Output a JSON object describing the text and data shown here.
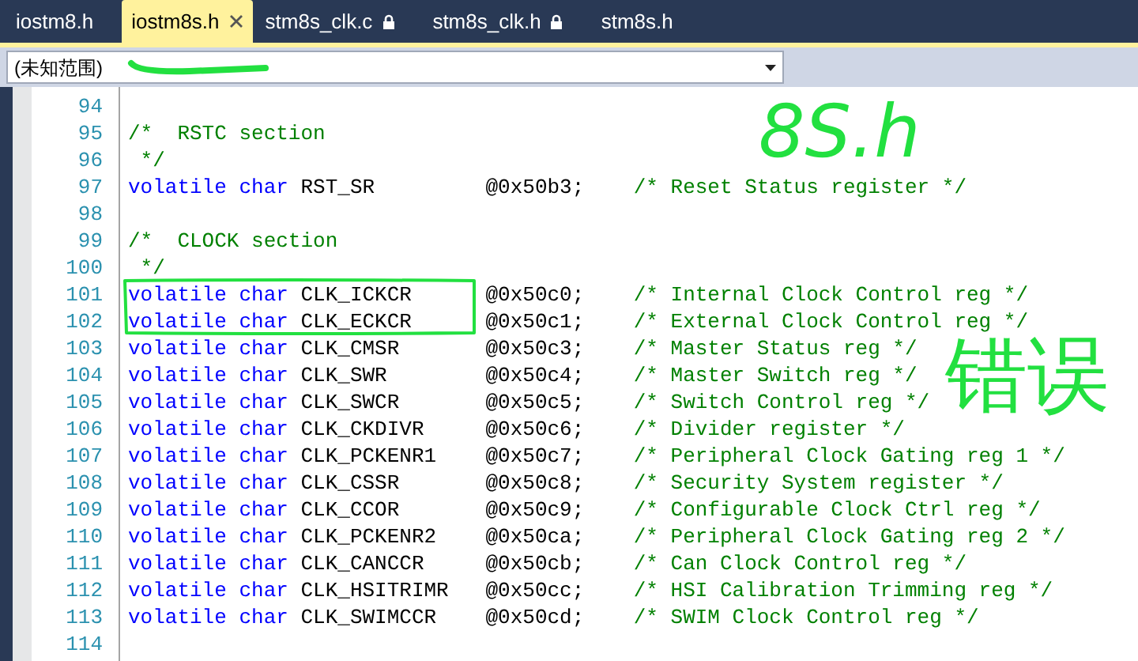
{
  "tabs": [
    {
      "label": "iostm8.h",
      "selected": false,
      "locked": false,
      "closable": false
    },
    {
      "label": "iostm8s.h",
      "selected": true,
      "locked": false,
      "closable": true
    },
    {
      "label": "stm8s_clk.c",
      "selected": false,
      "locked": true,
      "closable": false
    },
    {
      "label": "stm8s_clk.h",
      "selected": false,
      "locked": true,
      "closable": false
    },
    {
      "label": "stm8s.h",
      "selected": false,
      "locked": false,
      "closable": false
    }
  ],
  "scope_dropdown": {
    "value": "(未知范围)"
  },
  "lines": [
    {
      "number": "94",
      "kind": "blank"
    },
    {
      "number": "95",
      "kind": "comment",
      "text": "/*  RSTC section"
    },
    {
      "number": "96",
      "kind": "comment",
      "text": " */"
    },
    {
      "number": "97",
      "kind": "declaration",
      "qualifier": "volatile",
      "type": "char",
      "name": "RST_SR",
      "address": "@0x50b3;",
      "comment": "/* Reset Status register */"
    },
    {
      "number": "98",
      "kind": "blank"
    },
    {
      "number": "99",
      "kind": "comment",
      "text": "/*  CLOCK section"
    },
    {
      "number": "100",
      "kind": "comment",
      "text": " */"
    },
    {
      "number": "101",
      "kind": "declaration",
      "qualifier": "volatile",
      "type": "char",
      "name": "CLK_ICKCR",
      "address": "@0x50c0;",
      "comment": "/* Internal Clock Control reg */"
    },
    {
      "number": "102",
      "kind": "declaration",
      "qualifier": "volatile",
      "type": "char",
      "name": "CLK_ECKCR",
      "address": "@0x50c1;",
      "comment": "/* External Clock Control reg */"
    },
    {
      "number": "103",
      "kind": "declaration",
      "qualifier": "volatile",
      "type": "char",
      "name": "CLK_CMSR",
      "address": "@0x50c3;",
      "comment": "/* Master Status reg */"
    },
    {
      "number": "104",
      "kind": "declaration",
      "qualifier": "volatile",
      "type": "char",
      "name": "CLK_SWR",
      "address": "@0x50c4;",
      "comment": "/* Master Switch reg */"
    },
    {
      "number": "105",
      "kind": "declaration",
      "qualifier": "volatile",
      "type": "char",
      "name": "CLK_SWCR",
      "address": "@0x50c5;",
      "comment": "/* Switch Control reg */"
    },
    {
      "number": "106",
      "kind": "declaration",
      "qualifier": "volatile",
      "type": "char",
      "name": "CLK_CKDIVR",
      "address": "@0x50c6;",
      "comment": "/* Divider register */"
    },
    {
      "number": "107",
      "kind": "declaration",
      "qualifier": "volatile",
      "type": "char",
      "name": "CLK_PCKENR1",
      "address": "@0x50c7;",
      "comment": "/* Peripheral Clock Gating reg 1 */"
    },
    {
      "number": "108",
      "kind": "declaration",
      "qualifier": "volatile",
      "type": "char",
      "name": "CLK_CSSR",
      "address": "@0x50c8;",
      "comment": "/* Security System register */"
    },
    {
      "number": "109",
      "kind": "declaration",
      "qualifier": "volatile",
      "type": "char",
      "name": "CLK_CCOR",
      "address": "@0x50c9;",
      "comment": "/* Configurable Clock Ctrl reg */"
    },
    {
      "number": "110",
      "kind": "declaration",
      "qualifier": "volatile",
      "type": "char",
      "name": "CLK_PCKENR2",
      "address": "@0x50ca;",
      "comment": "/* Peripheral Clock Gating reg 2 */"
    },
    {
      "number": "111",
      "kind": "declaration",
      "qualifier": "volatile",
      "type": "char",
      "name": "CLK_CANCCR",
      "address": "@0x50cb;",
      "comment": "/* Can Clock Control reg */"
    },
    {
      "number": "112",
      "kind": "declaration",
      "qualifier": "volatile",
      "type": "char",
      "name": "CLK_HSITRIMR",
      "address": "@0x50cc;",
      "comment": "/* HSI Calibration Trimming reg */"
    },
    {
      "number": "113",
      "kind": "declaration",
      "qualifier": "volatile",
      "type": "char",
      "name": "CLK_SWIMCCR",
      "address": "@0x50cd;",
      "comment": "/* SWIM Clock Control reg */"
    },
    {
      "number": "114",
      "kind": "blank"
    }
  ],
  "annotations": [
    {
      "kind": "underline"
    },
    {
      "kind": "outline"
    },
    {
      "kind": "text",
      "text": "8S.h"
    },
    {
      "kind": "text",
      "text": "错误"
    }
  ]
}
